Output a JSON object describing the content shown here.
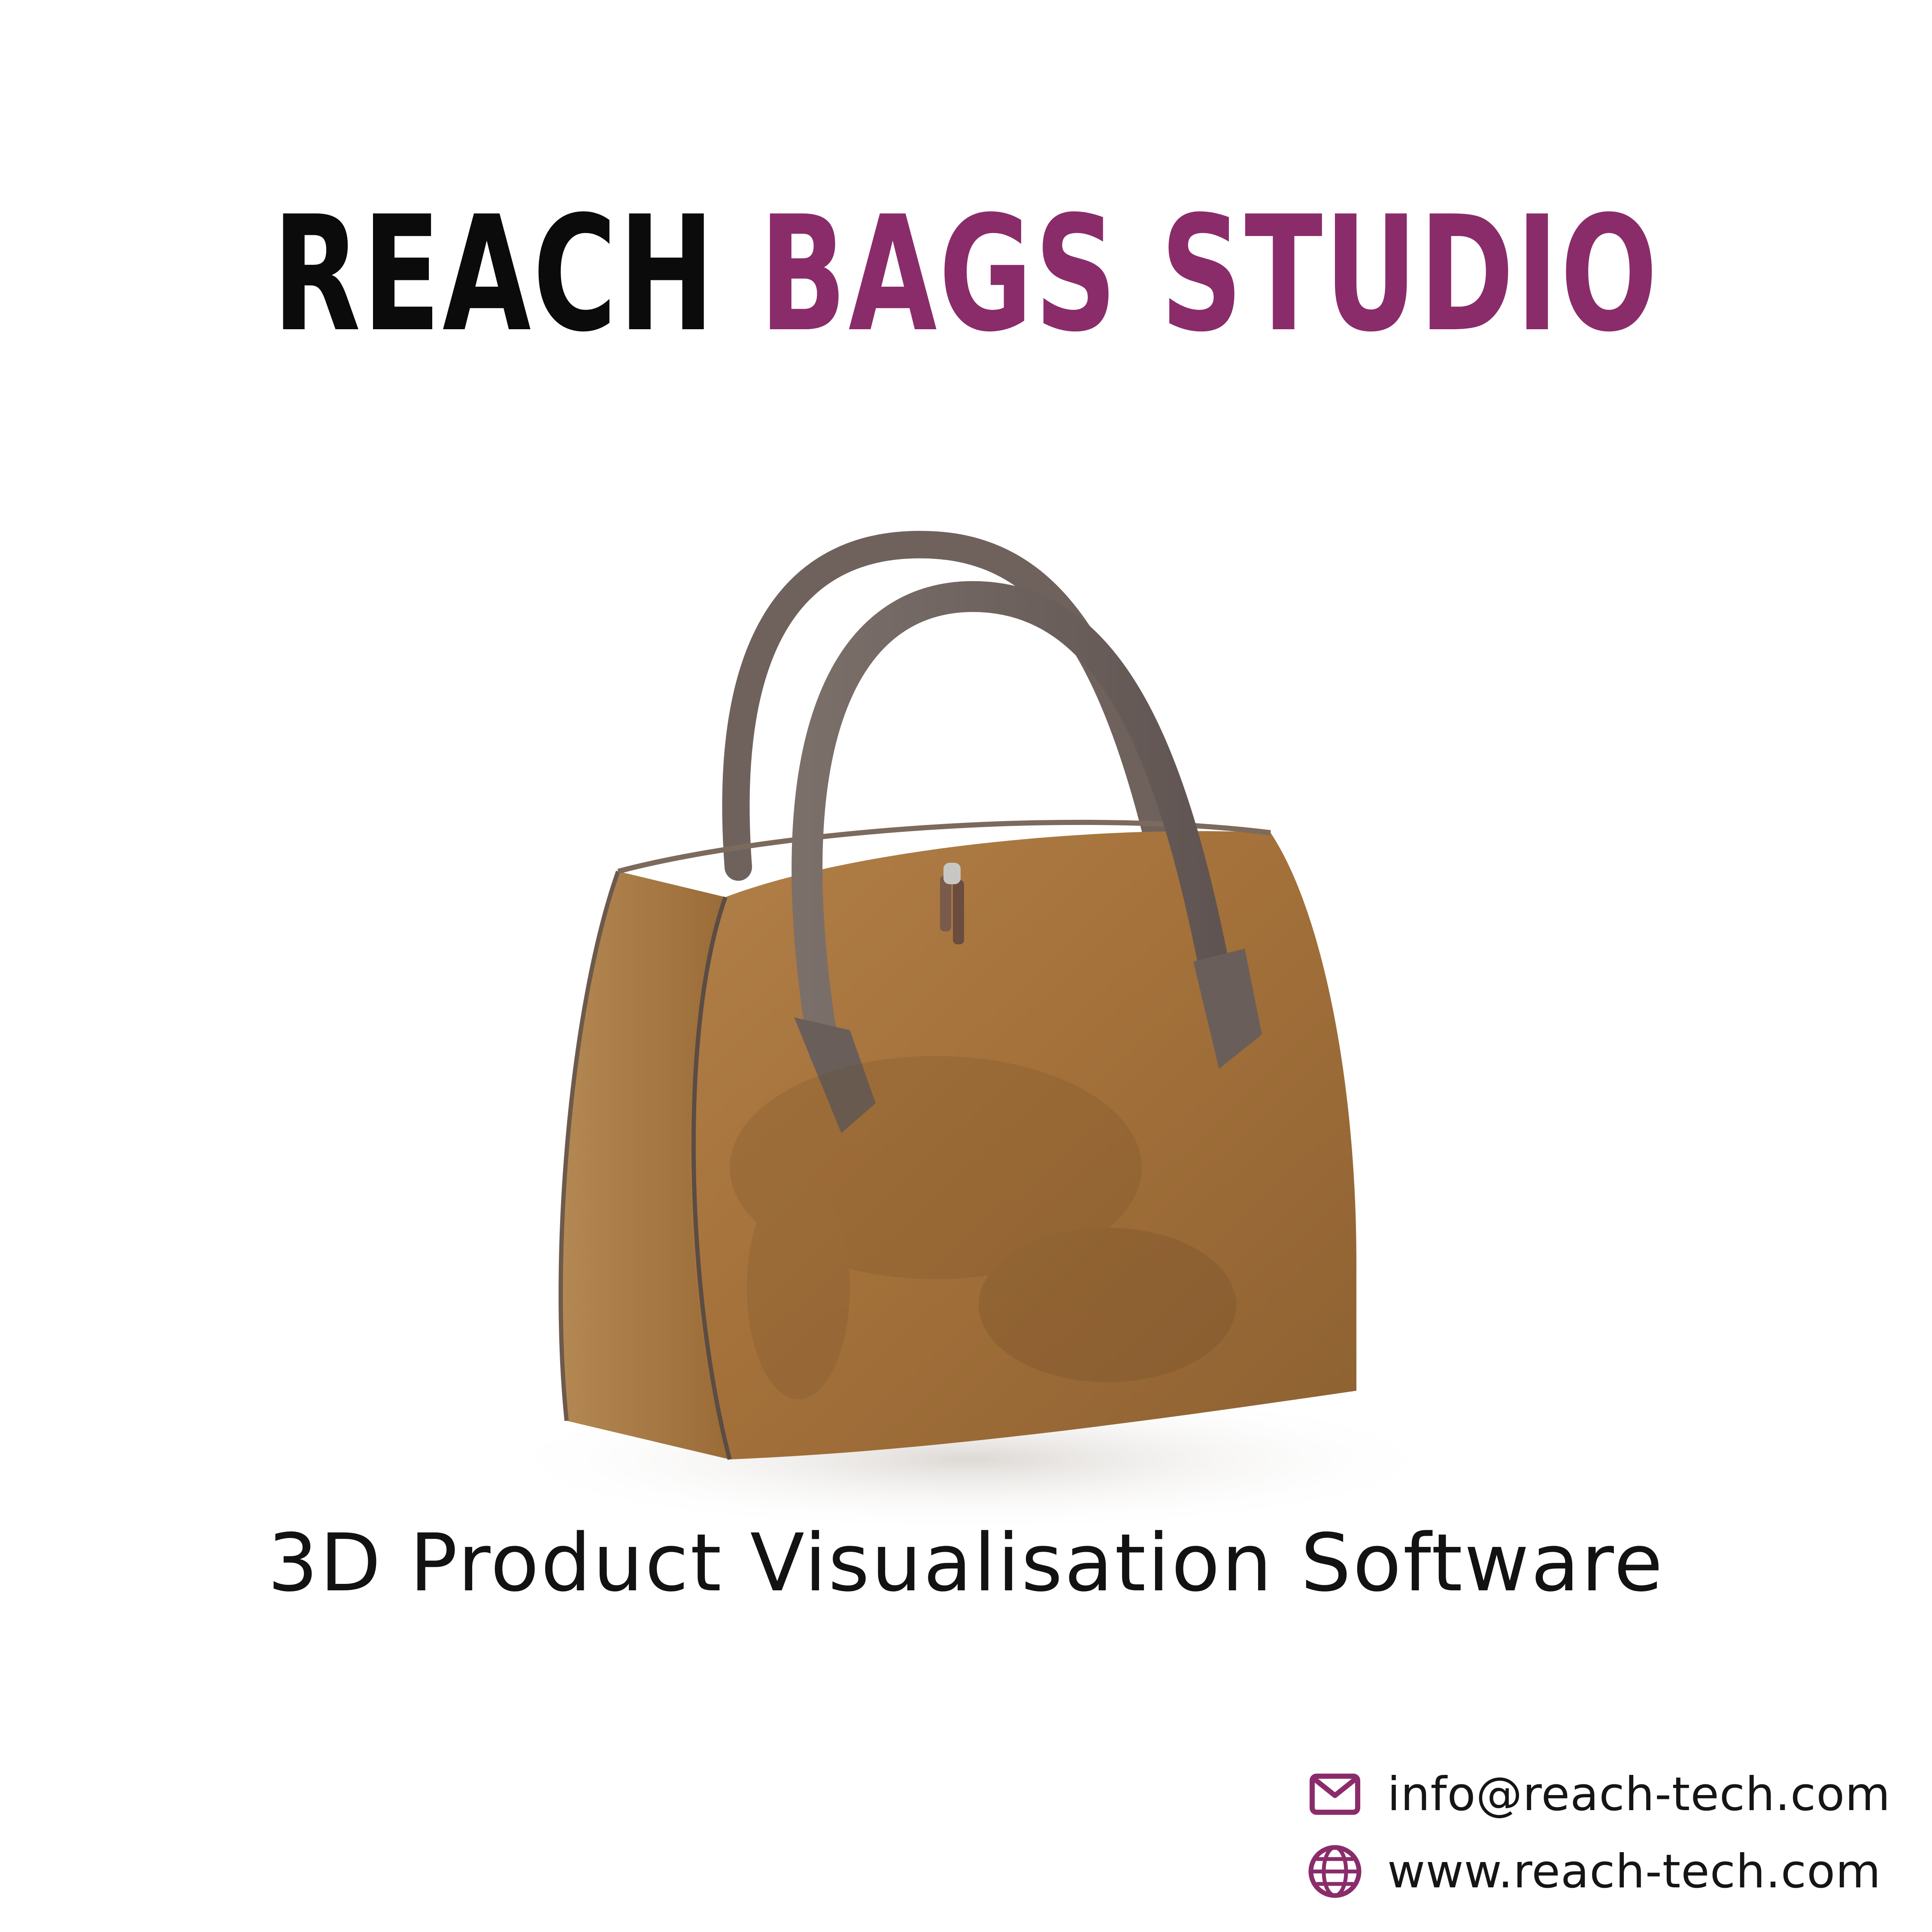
{
  "title": {
    "part1": "REACH",
    "part2": "BAGS STUDIO"
  },
  "subtitle": "3D Product Visualisation Software",
  "contact": {
    "email": "info@reach-tech.com",
    "email_icon": "mail-icon",
    "website": "www.reach-tech.com",
    "website_icon": "globe-icon"
  },
  "colors": {
    "title_dark": "#0b0b0b",
    "accent": "#8a2c6a",
    "bag_body": "#a8753f",
    "bag_handle": "#6f6360"
  }
}
